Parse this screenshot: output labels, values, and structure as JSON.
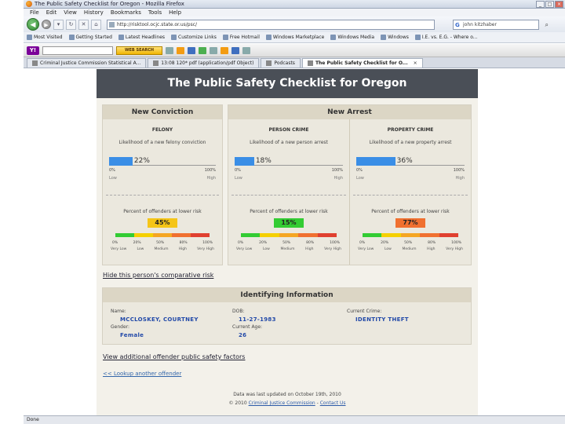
{
  "window": {
    "title": "The Public Safety Checklist for Oregon - Mozilla Firefox"
  },
  "menu": [
    "File",
    "Edit",
    "View",
    "History",
    "Bookmarks",
    "Tools",
    "Help"
  ],
  "nav": {
    "url": "http://risktool.ocjc.state.or.us/psc/",
    "search_value": "john kitzhaber"
  },
  "bookmarks": [
    "Most Visited",
    "Getting Started",
    "Latest Headlines",
    "Customize Links",
    "Free Hotmail",
    "Windows Marketplace",
    "Windows Media",
    "Windows",
    "I.E. vs. E.G. - Where o..."
  ],
  "yahoo": {
    "button": "WEB SEARCH"
  },
  "tabs": [
    "Criminal Justice Commission Statistical A...",
    "13:08 120* pdf (application/pdf Object)",
    "Podcasts",
    "The Public Safety Checklist for O..."
  ],
  "status": "Done",
  "page": {
    "title": "The Public Safety Checklist for Oregon",
    "conviction": {
      "heading": "New Conviction",
      "col": {
        "title": "FELONY",
        "likelihood": "Likelihood of a new felony conviction",
        "pct": "22%",
        "pct_value": 22,
        "percent_label": "Percent of offenders at lower risk",
        "badge": "45%",
        "badge_color": "#f5c518"
      }
    },
    "arrest": {
      "heading": "New Arrest",
      "cols": [
        {
          "title": "PERSON CRIME",
          "likelihood": "Likelihood of a new person arrest",
          "pct": "18%",
          "pct_value": 18,
          "percent_label": "Percent of offenders at lower risk",
          "badge": "15%",
          "badge_color": "#33cc33"
        },
        {
          "title": "PROPERTY CRIME",
          "likelihood": "Likelihood of a new property arrest",
          "pct": "36%",
          "pct_value": 36,
          "percent_label": "Percent of offenders at lower risk",
          "badge": "77%",
          "badge_color": "#f07030"
        }
      ]
    },
    "scale": {
      "left": "0%",
      "right": "100%",
      "low": "Low",
      "high": "High"
    },
    "ticks": [
      "0%",
      "20%",
      "50%",
      "80%",
      "100%"
    ],
    "risk_labels": [
      "Very Low",
      "Low",
      "Medium",
      "High",
      "Very High"
    ],
    "risk_colors": [
      "#33cc33",
      "#f5d000",
      "#f5a623",
      "#f07030",
      "#e04030"
    ],
    "hide_link": "Hide this person's comparative risk",
    "identifying": {
      "heading": "Identifying Information",
      "name_label": "Name:",
      "name": "MCCLOSKEY, COURTNEY",
      "dob_label": "DOB:",
      "dob": "11-27-1983",
      "crime_label": "Current Crime:",
      "crime": "IDENTITY THEFT",
      "gender_label": "Gender:",
      "gender": "Female",
      "age_label": "Current Age:",
      "age": "26"
    },
    "more_link": "View additional offender public safety factors",
    "lookup_link": "<< Lookup another offender",
    "footer_updated": "Data was last updated on October 19th, 2010",
    "footer_copyright": "© 2010",
    "footer_cjc": "Criminal Justice Commission",
    "footer_sep": "-",
    "footer_contact": "Contact Us"
  }
}
